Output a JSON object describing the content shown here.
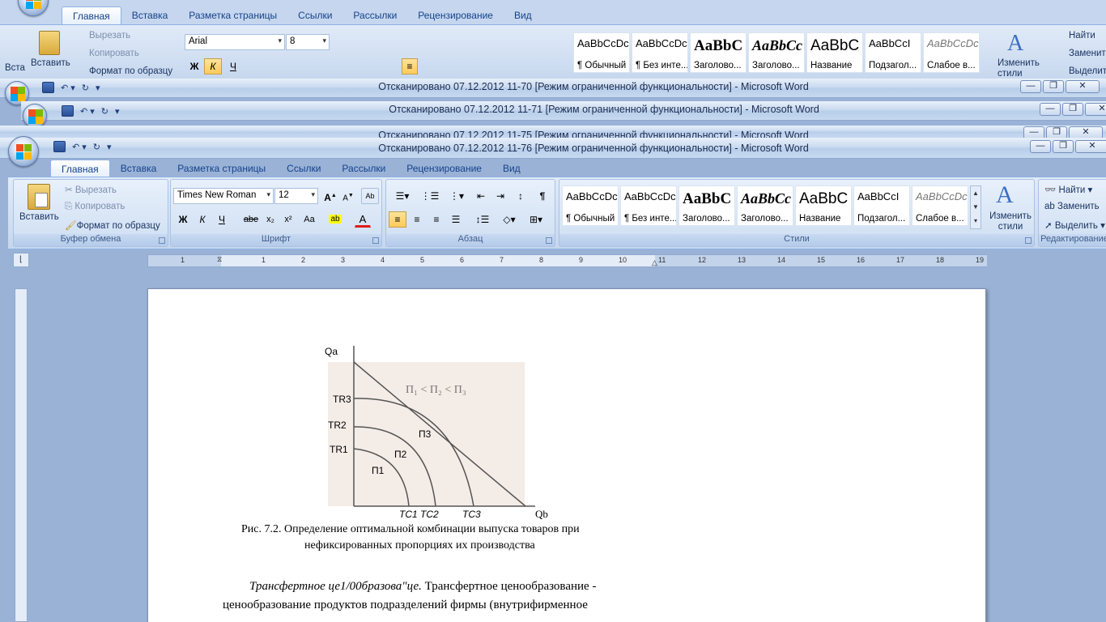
{
  "back_window": {
    "tabs": [
      "Главная",
      "Вставка",
      "Разметка страницы",
      "Ссылки",
      "Рассылки",
      "Рецензирование",
      "Вид"
    ],
    "clipboard": {
      "paste": "Вставить",
      "cut": "Вырезать",
      "copy": "Копировать",
      "format": "Формат по образцу",
      "partial": "Вста"
    },
    "font": {
      "name": "Arial",
      "size": "8"
    },
    "styles": [
      {
        "preview": "AaBbCcDc",
        "name": "¶ Обычный"
      },
      {
        "preview": "AaBbCcDc",
        "name": "¶ Без инте..."
      },
      {
        "preview": "AaBbC",
        "name": "Заголово..."
      },
      {
        "preview": "AaBbCc",
        "name": "Заголово..."
      },
      {
        "preview": "AaBbC",
        "name": "Название"
      },
      {
        "preview": "AaBbCcI",
        "name": "Подзагол..."
      },
      {
        "preview": "AaBbCcDc",
        "name": "Слабое в..."
      }
    ],
    "change_styles": "Изменить стили",
    "editing": {
      "find": "Найти",
      "replace": "Заменить",
      "select": "Выделить"
    }
  },
  "stacked_titles": [
    "Отсканировано 07.12.2012 11-70 [Режим ограниченной функциональности]  -  Microsoft Word",
    "Отсканировано 07.12.2012 11-71 [Режим ограниченной функциональности]  -  Microsoft Word",
    "Отсканировано 07.12.2012 11-75 [Режим ограниченной функциональности]  -  Microsoft Word"
  ],
  "window": {
    "title": "Отсканировано 07.12.2012 11-76 [Режим ограниченной функциональности]  -  Microsoft Word",
    "tabs": [
      "Главная",
      "Вставка",
      "Разметка страницы",
      "Ссылки",
      "Рассылки",
      "Рецензирование",
      "Вид"
    ],
    "clipboard": {
      "paste": "Вставить",
      "cut": "Вырезать",
      "copy": "Копировать",
      "format": "Формат по образцу",
      "label": "Буфер обмена"
    },
    "font": {
      "name": "Times New Roman",
      "size": "12",
      "label": "Шрифт",
      "bold": "Ж",
      "italic": "К",
      "underline": "Ч",
      "strike": "abe",
      "sub": "x₂",
      "sup": "x²",
      "case": "Aa"
    },
    "paragraph": {
      "label": "Абзац"
    },
    "styles": {
      "label": "Стили",
      "items": [
        {
          "preview": "AaBbCcDc",
          "name": "¶ Обычный"
        },
        {
          "preview": "AaBbCcDc",
          "name": "¶ Без инте..."
        },
        {
          "preview": "AaBbC",
          "name": "Заголово..."
        },
        {
          "preview": "AaBbCc",
          "name": "Заголово..."
        },
        {
          "preview": "AaBbC",
          "name": "Название"
        },
        {
          "preview": "AaBbCcI",
          "name": "Подзагол..."
        },
        {
          "preview": "AaBbCcDc",
          "name": "Слабое в..."
        }
      ],
      "change": "Изменить стили"
    },
    "editing": {
      "label": "Редактирование",
      "find": "Найти",
      "replace": "Заменить",
      "select": "Выделить"
    }
  },
  "ruler": {
    "numbers": [
      "1",
      "1",
      "2",
      "3",
      "4",
      "5",
      "6",
      "7",
      "8",
      "9",
      "10",
      "11",
      "12",
      "13",
      "14",
      "15",
      "16",
      "17",
      "18",
      "19"
    ]
  },
  "figure": {
    "y_axis": "Qa",
    "x_axis": "Qb",
    "tr_labels": [
      "TR3",
      "TR2",
      "TR1"
    ],
    "profit_labels": [
      "П3",
      "П2",
      "П1"
    ],
    "inequality": "П₁ < П₂ < П₃",
    "tc_labels": "ТС1 ТС2",
    "tc3": "ТС3"
  },
  "caption": {
    "line1": "Рис. 7.2. Определение оптимальной комбинации выпуска товаров при",
    "line2": "нефиксированных пропорциях их производства"
  },
  "body_text": {
    "italic_lead": "Трансфертное це1/00бразова\"це.",
    "line1_rest": " Трансфертное ценообразование -",
    "line2": "ценообразование продуктов подразделений фирмы (внутрифирменное"
  }
}
